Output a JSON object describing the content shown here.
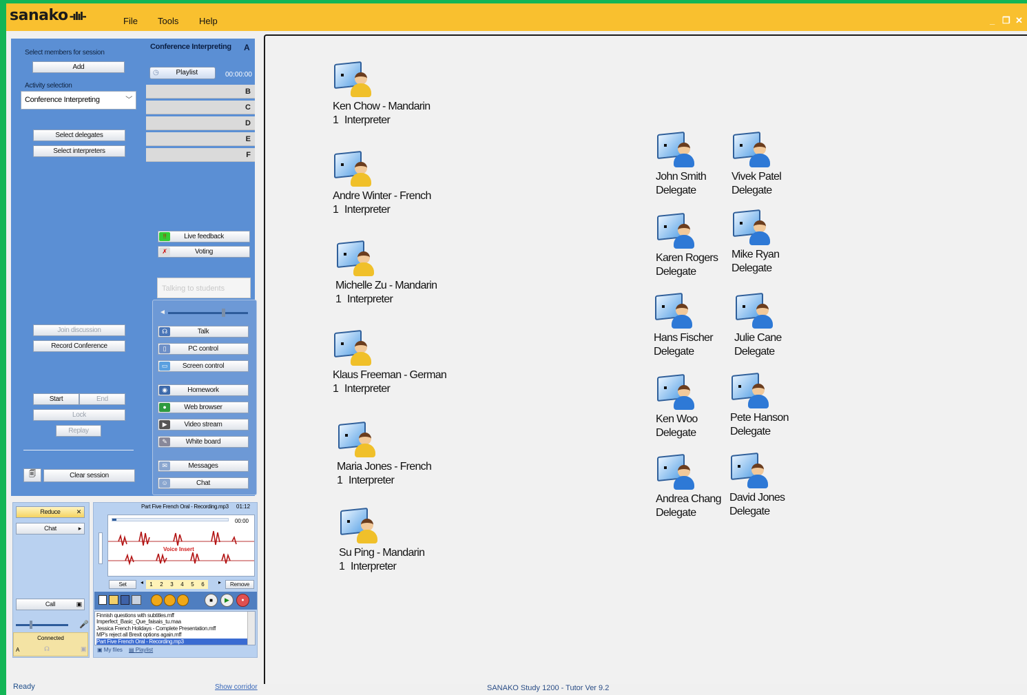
{
  "app": {
    "logo": "sanako",
    "menu": [
      "File",
      "Tools",
      "Help"
    ],
    "window_controls": [
      "_",
      "❐",
      "✕"
    ]
  },
  "left": {
    "select_members_label": "Select members for session",
    "add": "Add",
    "activity_label": "Activity selection",
    "activity_value": "Conference Interpreting",
    "select_delegates": "Select delegates",
    "select_interpreters": "Select interpreters",
    "join_discussion": "Join discussion",
    "record_conference": "Record Conference",
    "start": "Start",
    "end": "End",
    "lock": "Lock",
    "replay": "Replay",
    "clear_session": "Clear session"
  },
  "conference": {
    "title": "Conference Interpreting",
    "lane_a": "A",
    "playlist": "Playlist",
    "time": "00:00:00",
    "lanes": [
      "B",
      "C",
      "D",
      "E",
      "F"
    ]
  },
  "tools": {
    "live_feedback": "Live feedback",
    "voting": "Voting",
    "talking_placeholder": "Talking to students",
    "buttons": [
      "Talk",
      "PC control",
      "Screen control",
      "Homework",
      "Web browser",
      "Video stream",
      "White board",
      "Messages",
      "Chat"
    ]
  },
  "bottom_left": {
    "reduce": "Reduce",
    "chat": "Chat",
    "call": "Call",
    "connected": "Connected",
    "channel": "A"
  },
  "recorder": {
    "file_title": "Part Five French Oral - Recording.mp3",
    "duration": "01:12",
    "position": "00:00",
    "voice_insert": "Voice Insert",
    "set": "Set",
    "bookmarks": [
      "1",
      "2",
      "3",
      "4",
      "5",
      "6"
    ],
    "remove": "Remove",
    "files": [
      "Finnish questions with subtitles.mff",
      "Imperfect_Basic_Que_faisais_tu.maa",
      "Jessica French Holidays - Complete Presentation.mff",
      "MP's reject all Brexit options again.mff",
      "Part Five French Oral - Recording.mp3"
    ],
    "selected_file_index": 4,
    "tab_my_files": "My files",
    "tab_playlist": "Playlist"
  },
  "members": {
    "interpreters": [
      {
        "name": "Ken Chow - Mandarin",
        "num": "1",
        "role": "Interpreter"
      },
      {
        "name": "Andre Winter - French",
        "num": "1",
        "role": "Interpreter"
      },
      {
        "name": "Michelle Zu - Mandarin",
        "num": "1",
        "role": "Interpreter"
      },
      {
        "name": "Klaus Freeman - German",
        "num": "1",
        "role": "Interpreter"
      },
      {
        "name": "Maria Jones - French",
        "num": "1",
        "role": "Interpreter"
      },
      {
        "name": "Su Ping - Mandarin",
        "num": "1",
        "role": "Interpreter"
      }
    ],
    "delegates": [
      {
        "name": "John Smith",
        "role": "Delegate"
      },
      {
        "name": "Vivek Patel",
        "role": "Delegate"
      },
      {
        "name": "Karen Rogers",
        "role": "Delegate"
      },
      {
        "name": "Mike Ryan",
        "role": "Delegate"
      },
      {
        "name": "Hans Fischer",
        "role": "Delegate"
      },
      {
        "name": "Julie Cane",
        "role": "Delegate"
      },
      {
        "name": "Ken Woo",
        "role": "Delegate"
      },
      {
        "name": "Pete Hanson",
        "role": "Delegate"
      },
      {
        "name": "Andrea Chang",
        "role": "Delegate"
      },
      {
        "name": "David Jones",
        "role": "Delegate"
      }
    ]
  },
  "status": {
    "ready": "Ready",
    "show_corridor": "Show corridor",
    "version": "SANAKO Study 1200 - Tutor  Ver 9.2"
  }
}
